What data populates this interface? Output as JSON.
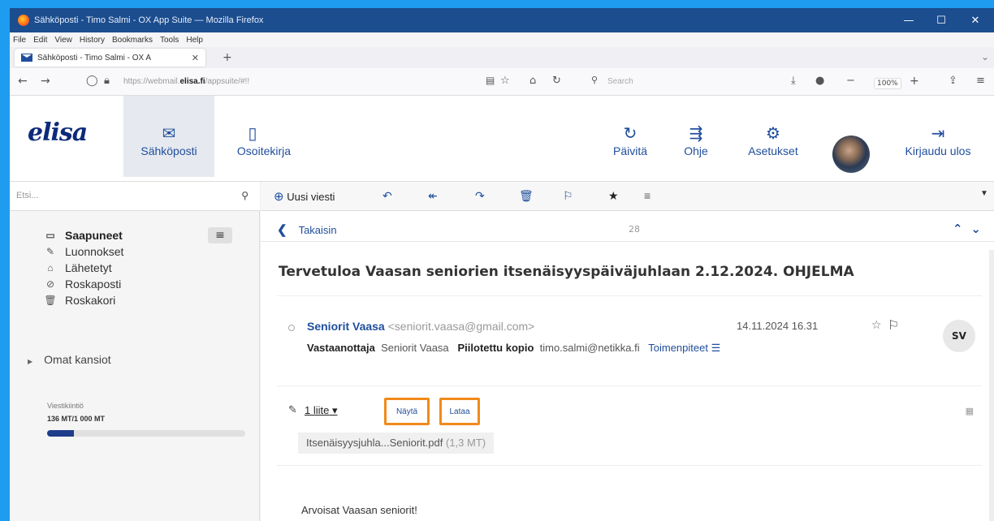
{
  "window": {
    "title": "Sähköposti - Timo Salmi - OX App Suite — Mozilla Firefox",
    "minimize": "—",
    "maximize": "☐",
    "close": "✕"
  },
  "menubar": [
    "File",
    "Edit",
    "View",
    "History",
    "Bookmarks",
    "Tools",
    "Help"
  ],
  "tab": {
    "title": "Sähköposti - Timo Salmi - OX A",
    "close": "✕",
    "new": "+"
  },
  "navbar": {
    "url_prefix": "https://webmail.",
    "url_domain": "elisa.fi",
    "url_suffix": "/appsuite/#!!",
    "search_placeholder": "Search",
    "zoom": "100%"
  },
  "app": {
    "logo": "elisa",
    "buttons": {
      "mail": "Sähköposti",
      "contacts": "Osoitekirja",
      "refresh": "Päivitä",
      "help": "Ohje",
      "settings": "Asetukset",
      "logout": "Kirjaudu ulos"
    }
  },
  "sidebar": {
    "search_placeholder": "Etsi...",
    "folders": [
      {
        "label": "Saapuneet",
        "icon": "inbox-icon"
      },
      {
        "label": "Luonnokset",
        "icon": "drafts-icon"
      },
      {
        "label": "Lähetetyt",
        "icon": "sent-icon"
      },
      {
        "label": "Roskaposti",
        "icon": "spam-icon"
      },
      {
        "label": "Roskakori",
        "icon": "trash-icon"
      }
    ],
    "own_folders": "Omat kansiot",
    "quota_label": "Viestikiintiö",
    "quota_value": "136 MT/1 000 MT",
    "quota_fraction": 0.136
  },
  "toolbar": {
    "new_message": "Uusi viesti"
  },
  "message": {
    "back": "Takaisin",
    "count": "28",
    "subject": "Tervetuloa Vaasan seniorien itsenäisyyspäiväjuhlaan 2.12.2024. OHJELMA",
    "from_name": "Seniorit Vaasa",
    "from_email": "<seniorit.vaasa@gmail.com>",
    "date": "14.11.2024 16.31",
    "avatar_initials": "SV",
    "to_label": "Vastaanottaja",
    "to_value": "Seniorit Vaasa",
    "bcc_label": "Piilotettu kopio",
    "bcc_value": "timo.salmi@netikka.fi",
    "actions": "Toimenpiteet",
    "attachment_count": "1 liite",
    "view_button": "Näytä",
    "download_button": "Lataa",
    "file_name": "Itsenäisyysjuhla...Seniorit.pdf",
    "file_size": "(1,3 MT)",
    "body_greeting": "Arvoisat Vaasan seniorit!"
  },
  "colors": {
    "accent": "#1f4e9c",
    "highlight": "#f08a1a"
  }
}
